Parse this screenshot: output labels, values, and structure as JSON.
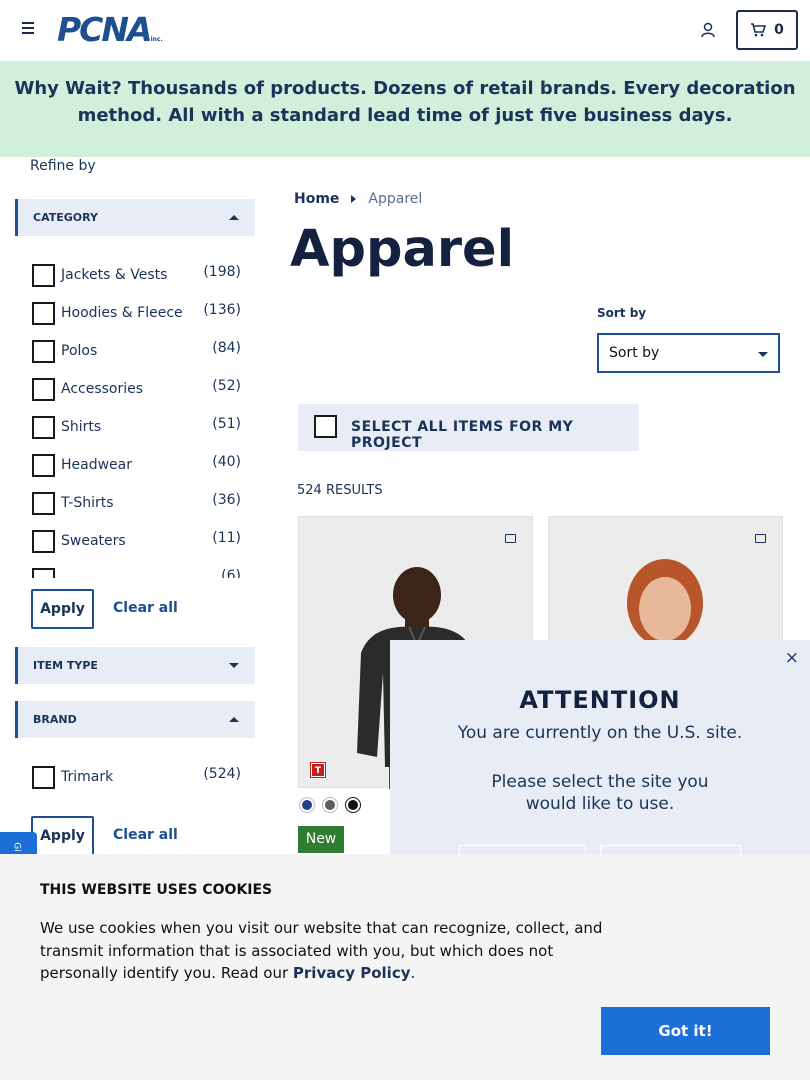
{
  "header": {
    "logo_text": "PCNA",
    "logo_suffix": "inc.",
    "cart_count": "0"
  },
  "banner": {
    "lead": "Why Wait?",
    "text": " Thousands of products. Dozens of retail brands. Every decoration method. All with a standard lead time of just five business days."
  },
  "sidebar": {
    "refine_label": "Refine by",
    "category": {
      "title": "CATEGORY",
      "items": [
        {
          "label": "Jackets & Vests",
          "count": "(198)"
        },
        {
          "label": "Hoodies & Fleece",
          "count": "(136)"
        },
        {
          "label": "Polos",
          "count": "(84)"
        },
        {
          "label": "Accessories",
          "count": "(52)"
        },
        {
          "label": "Shirts",
          "count": "(51)"
        },
        {
          "label": "Headwear",
          "count": "(40)"
        },
        {
          "label": "T-Shirts",
          "count": "(36)"
        },
        {
          "label": "Sweaters",
          "count": "(11)"
        },
        {
          "label": "",
          "count": "(6)"
        }
      ],
      "apply_label": "Apply",
      "clear_label": "Clear all"
    },
    "item_type": {
      "title": "ITEM TYPE"
    },
    "brand": {
      "title": "BRAND",
      "items": [
        {
          "label": "Trimark",
          "count": "(524)"
        }
      ],
      "apply_label": "Apply",
      "clear_label": "Clear all"
    },
    "side_tab": "Gi"
  },
  "main": {
    "breadcrumb": {
      "home": "Home",
      "current": "Apparel"
    },
    "title": "Apparel",
    "sort_label": "Sort by",
    "sort_value": "Sort by",
    "select_all_label": "SELECT ALL ITEMS FOR MY PROJECT",
    "results": "524 RESULTS",
    "products": [
      {
        "badge_letter": "T",
        "swatches": [
          "#1f3f8f",
          "#5c5c5c",
          "#111111"
        ],
        "tag": "New"
      },
      {
        "badge_letter": "",
        "swatches": [],
        "tag": ""
      }
    ]
  },
  "modal": {
    "close": "×",
    "title": "ATTENTION",
    "line1": "You are currently on the U.S. site.",
    "line2": "Please select the site you",
    "line3": "would like to use."
  },
  "cookie": {
    "title": "THIS WEBSITE USES COOKIES",
    "text": "We use cookies when you visit our website that can recognize, collect, and transmit information that is associated with you, but which does not personally identify you. Read our ",
    "link": "Privacy Policy",
    "end": ".",
    "button": "Got it!"
  },
  "colors": {
    "brand": "#1d4f91",
    "banner_bg": "#d2efdc",
    "accept": "#1d6fd8",
    "new_badge": "#2e7d32"
  }
}
